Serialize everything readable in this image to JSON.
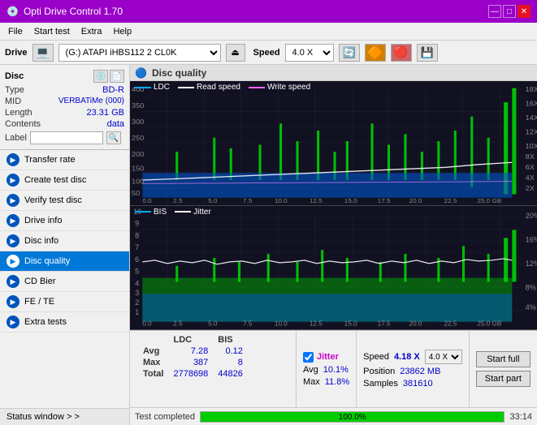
{
  "app": {
    "title": "Opti Drive Control 1.70",
    "icon": "💿"
  },
  "title_controls": {
    "minimize": "—",
    "maximize": "□",
    "close": "✕"
  },
  "menu": {
    "items": [
      "File",
      "Start test",
      "Extra",
      "Help"
    ]
  },
  "drive_bar": {
    "label": "Drive",
    "drive_value": "(G:) ATAPI iHBS112  2 CL0K",
    "speed_label": "Speed",
    "speed_value": "4.0 X"
  },
  "disc": {
    "header": "Disc",
    "type_label": "Type",
    "type_value": "BD-R",
    "mid_label": "MID",
    "mid_value": "VERBATiMe (000)",
    "length_label": "Length",
    "length_value": "23.31 GB",
    "contents_label": "Contents",
    "contents_value": "data",
    "label_label": "Label",
    "label_value": ""
  },
  "nav_items": [
    {
      "id": "transfer-rate",
      "label": "Transfer rate",
      "active": false
    },
    {
      "id": "create-test-disc",
      "label": "Create test disc",
      "active": false
    },
    {
      "id": "verify-test-disc",
      "label": "Verify test disc",
      "active": false
    },
    {
      "id": "drive-info",
      "label": "Drive info",
      "active": false
    },
    {
      "id": "disc-info",
      "label": "Disc info",
      "active": false
    },
    {
      "id": "disc-quality",
      "label": "Disc quality",
      "active": true
    },
    {
      "id": "cd-bier",
      "label": "CD Bier",
      "active": false
    },
    {
      "id": "fe-te",
      "label": "FE / TE",
      "active": false
    },
    {
      "id": "extra-tests",
      "label": "Extra tests",
      "active": false
    }
  ],
  "status_window_label": "Status window > >",
  "chart": {
    "title": "Disc quality",
    "legend_top": [
      {
        "label": "LDC",
        "color": "#00aaff"
      },
      {
        "label": "Read speed",
        "color": "#ffffff"
      },
      {
        "label": "Write speed",
        "color": "#ff66ff"
      }
    ],
    "legend_bottom": [
      {
        "label": "BIS",
        "color": "#00aaff"
      },
      {
        "label": "Jitter",
        "color": "#ffffff"
      }
    ],
    "top_y_labels": [
      "400",
      "350",
      "300",
      "250",
      "200",
      "150",
      "100",
      "50"
    ],
    "top_y_right": [
      "18X",
      "16X",
      "14X",
      "12X",
      "10X",
      "8X",
      "6X",
      "4X",
      "2X"
    ],
    "top_x_labels": [
      "0.0",
      "2.5",
      "5.0",
      "7.5",
      "10.0",
      "12.5",
      "15.0",
      "17.5",
      "20.0",
      "22.5",
      "25.0 GB"
    ],
    "bottom_y_labels": [
      "10",
      "9",
      "8",
      "7",
      "6",
      "5",
      "4",
      "3",
      "2",
      "1"
    ],
    "bottom_y_right": [
      "20%",
      "16%",
      "12%",
      "8%",
      "4%"
    ],
    "bottom_x_labels": [
      "0.0",
      "2.5",
      "5.0",
      "7.5",
      "10.0",
      "12.5",
      "15.0",
      "17.5",
      "20.0",
      "22.5",
      "25.0 GB"
    ]
  },
  "stats": {
    "columns": [
      "",
      "LDC",
      "BIS"
    ],
    "rows": [
      {
        "label": "Avg",
        "ldc": "7.28",
        "bis": "0.12"
      },
      {
        "label": "Max",
        "ldc": "387",
        "bis": "8"
      },
      {
        "label": "Total",
        "ldc": "2778698",
        "bis": "44826"
      }
    ],
    "jitter_label": "Jitter",
    "jitter_avg": "10.1%",
    "jitter_max": "11.8%",
    "speed_label": "Speed",
    "speed_value": "4.18 X",
    "speed_select": "4.0 X",
    "position_label": "Position",
    "position_value": "23862 MB",
    "samples_label": "Samples",
    "samples_value": "381610",
    "btn_start_full": "Start full",
    "btn_start_part": "Start part"
  },
  "bottom_status": {
    "message": "Test completed",
    "progress_pct": 100,
    "progress_text": "100.0%",
    "time": "33:14"
  }
}
